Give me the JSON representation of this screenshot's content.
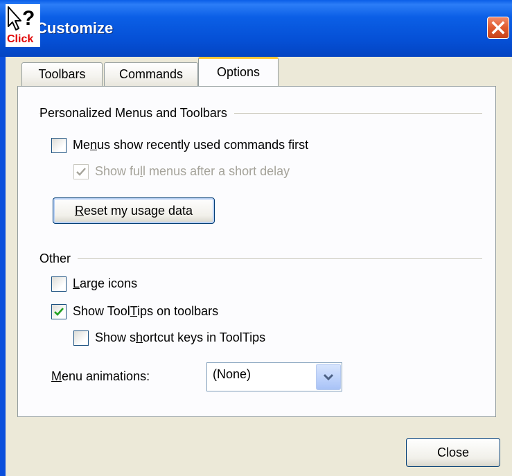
{
  "window": {
    "title": "Customize",
    "help_cursor_label": "Click",
    "colors": {
      "titlebar": "#0550d6",
      "face": "#ece9d8",
      "close_button": "#e05a2e",
      "tab_highlight": "#ffc83c"
    }
  },
  "tabs": [
    {
      "label": "Toolbars",
      "active": false
    },
    {
      "label": "Commands",
      "active": false
    },
    {
      "label": "Options",
      "active": true
    }
  ],
  "personalized": {
    "group_label": "Personalized Menus and Toolbars",
    "recent_first": {
      "pre": "Me",
      "key": "n",
      "post": "us show recently used commands first",
      "checked": false,
      "enabled": true
    },
    "full_menus": {
      "pre": "Show fu",
      "key": "l",
      "post": "l menus after a short delay",
      "checked": true,
      "enabled": false
    },
    "reset_button": {
      "key": "R",
      "post": "eset my usage data"
    }
  },
  "other": {
    "group_label": "Other",
    "large_icons": {
      "pre": "",
      "key": "L",
      "post": "arge icons",
      "checked": false
    },
    "show_tooltips": {
      "pre": "Show Tool",
      "key": "T",
      "post": "ips on toolbars",
      "checked": true
    },
    "shortcut_keys": {
      "pre": "Show s",
      "key": "h",
      "post": "ortcut keys in ToolTips",
      "checked": false
    },
    "menu_animations": {
      "label_key": "M",
      "label_post": "enu animations:",
      "value": "(None)"
    }
  },
  "footer": {
    "close_label": "Close"
  },
  "icons": [
    "help-cursor-icon",
    "close-x-icon",
    "checkmark-icon",
    "dropdown-arrow-icon"
  ]
}
